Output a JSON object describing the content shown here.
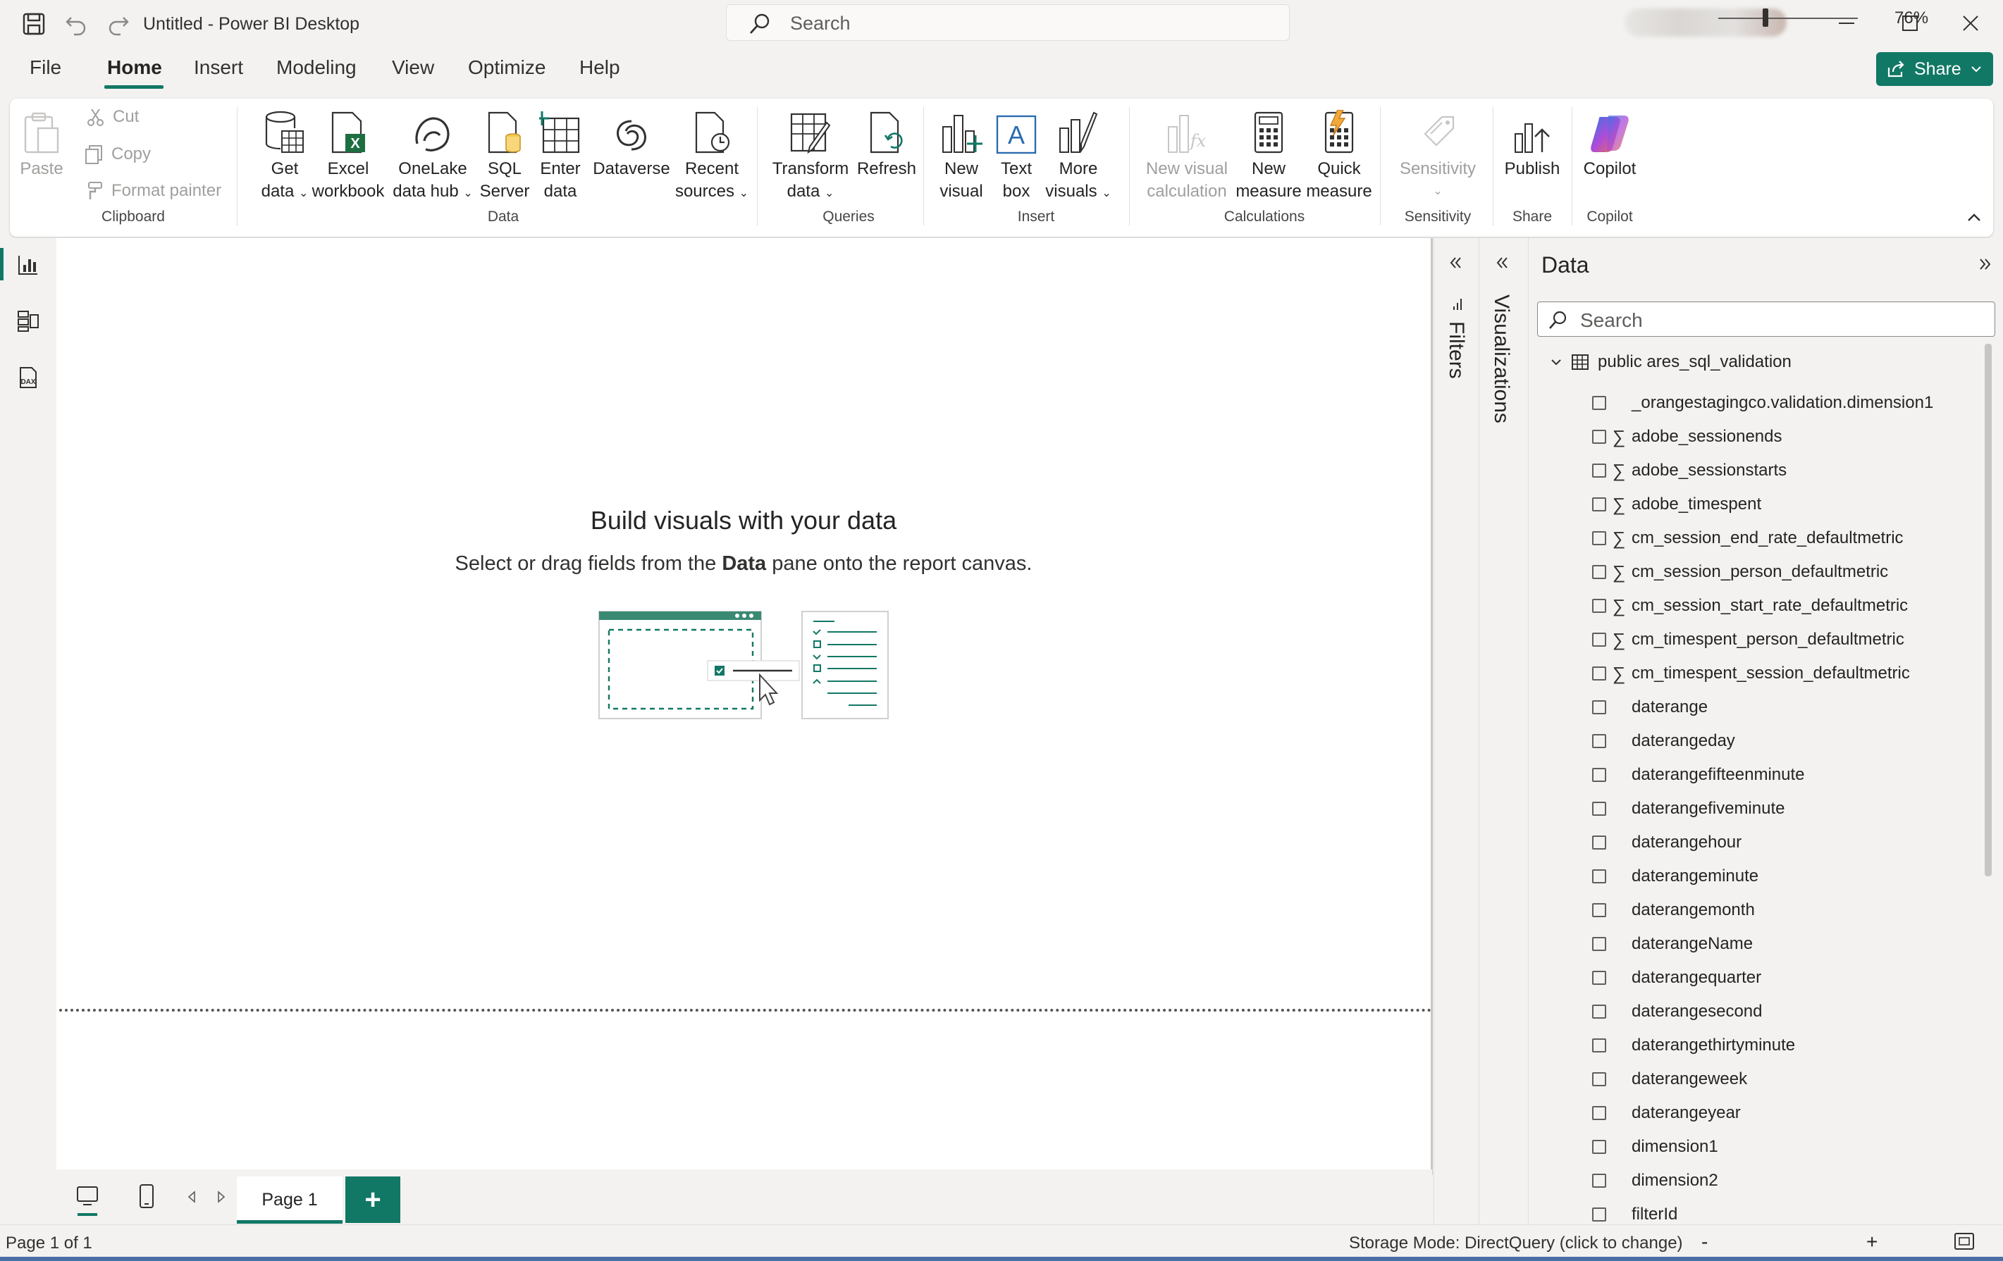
{
  "window": {
    "title": "Untitled - Power BI Desktop",
    "search_placeholder": "Search"
  },
  "menu": {
    "items": [
      "File",
      "Home",
      "Insert",
      "Modeling",
      "View",
      "Optimize",
      "Help"
    ],
    "active": "Home",
    "share_label": "Share"
  },
  "ribbon": {
    "clipboard": {
      "paste": "Paste",
      "cut": "Cut",
      "copy": "Copy",
      "format_painter": "Format painter",
      "group": "Clipboard"
    },
    "data": {
      "get_data_1": "Get",
      "get_data_2": "data",
      "excel_1": "Excel",
      "excel_2": "workbook",
      "onelake_1": "OneLake",
      "onelake_2": "data hub",
      "sql_1": "SQL",
      "sql_2": "Server",
      "enter_1": "Enter",
      "enter_2": "data",
      "dataverse": "Dataverse",
      "recent_1": "Recent",
      "recent_2": "sources",
      "group": "Data"
    },
    "queries": {
      "transform_1": "Transform",
      "transform_2": "data",
      "refresh": "Refresh",
      "group": "Queries"
    },
    "insert": {
      "new_visual_1": "New",
      "new_visual_2": "visual",
      "text_box_1": "Text",
      "text_box_2": "box",
      "more_visuals_1": "More",
      "more_visuals_2": "visuals",
      "group": "Insert"
    },
    "calculations": {
      "new_visual_calc_1": "New visual",
      "new_visual_calc_2": "calculation",
      "new_measure_1": "New",
      "new_measure_2": "measure",
      "quick_measure_1": "Quick",
      "quick_measure_2": "measure",
      "group": "Calculations"
    },
    "sensitivity": {
      "label": "Sensitivity",
      "group": "Sensitivity"
    },
    "share": {
      "publish": "Publish",
      "group": "Share"
    },
    "copilot": {
      "label": "Copilot",
      "group": "Copilot"
    }
  },
  "canvas": {
    "empty_title": "Build visuals with your data",
    "empty_sub_1": "Select or drag fields from the ",
    "empty_sub_bold": "Data",
    "empty_sub_2": " pane onto the report canvas."
  },
  "pages": {
    "tabs": [
      "Page 1"
    ],
    "add": "+"
  },
  "status": {
    "page": "Page 1 of 1",
    "storage": "Storage Mode: DirectQuery (click to change)",
    "zoom_minus": "-",
    "zoom_plus": "+",
    "zoom": "76%",
    "zoom_level": 0.34
  },
  "panes": {
    "filters": "Filters",
    "visualizations": "Visualizations",
    "data": {
      "title": "Data",
      "search_placeholder": "Search",
      "table": "public ares_sql_validation",
      "fields": [
        {
          "name": "_orangestagingco.validation.dimension1",
          "sum": false
        },
        {
          "name": "adobe_sessionends",
          "sum": true
        },
        {
          "name": "adobe_sessionstarts",
          "sum": true
        },
        {
          "name": "adobe_timespent",
          "sum": true
        },
        {
          "name": "cm_session_end_rate_defaultmetric",
          "sum": true
        },
        {
          "name": "cm_session_person_defaultmetric",
          "sum": true
        },
        {
          "name": "cm_session_start_rate_defaultmetric",
          "sum": true
        },
        {
          "name": "cm_timespent_person_defaultmetric",
          "sum": true
        },
        {
          "name": "cm_timespent_session_defaultmetric",
          "sum": true
        },
        {
          "name": "daterange",
          "sum": false
        },
        {
          "name": "daterangeday",
          "sum": false
        },
        {
          "name": "daterangefifteenminute",
          "sum": false
        },
        {
          "name": "daterangefiveminute",
          "sum": false
        },
        {
          "name": "daterangehour",
          "sum": false
        },
        {
          "name": "daterangeminute",
          "sum": false
        },
        {
          "name": "daterangemonth",
          "sum": false
        },
        {
          "name": "daterangeName",
          "sum": false
        },
        {
          "name": "daterangequarter",
          "sum": false
        },
        {
          "name": "daterangesecond",
          "sum": false
        },
        {
          "name": "daterangethirtyminute",
          "sum": false
        },
        {
          "name": "daterangeweek",
          "sum": false
        },
        {
          "name": "daterangeyear",
          "sum": false
        },
        {
          "name": "dimension1",
          "sum": false
        },
        {
          "name": "dimension2",
          "sum": false
        },
        {
          "name": "filterId",
          "sum": false
        }
      ]
    }
  },
  "colors": {
    "accent": "#117865",
    "background": "#f3f2f1",
    "canvas": "#ffffff"
  }
}
